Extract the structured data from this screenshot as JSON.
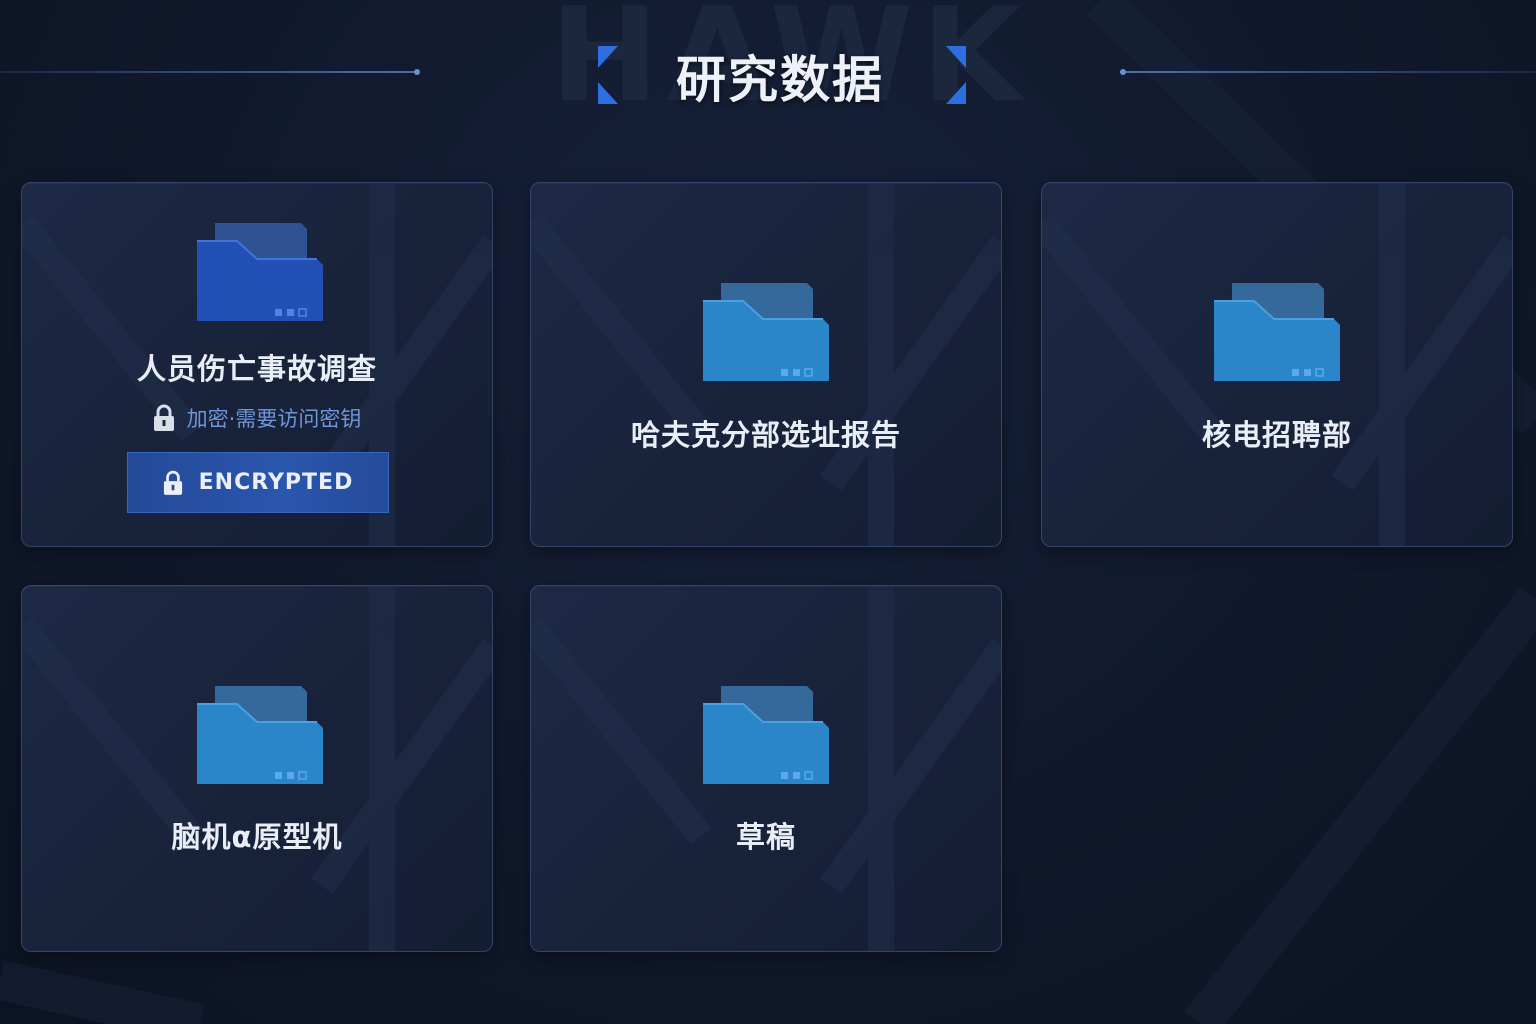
{
  "header": {
    "title": "研究数据",
    "watermark": "HAWK"
  },
  "colors": {
    "accent": "#2f6ee0",
    "folder_locked": "#2350b4",
    "folder_normal": "#2a85c9"
  },
  "folders": [
    {
      "name": "人员伤亡事故调查",
      "locked": true,
      "lock_note": "加密·需要访问密钥",
      "badge": "ENCRYPTED"
    },
    {
      "name": "哈夫克分部选址报告",
      "locked": false
    },
    {
      "name": "核电招聘部",
      "locked": false
    },
    {
      "name": "脑机α原型机",
      "locked": false
    },
    {
      "name": "草稿",
      "locked": false
    }
  ]
}
